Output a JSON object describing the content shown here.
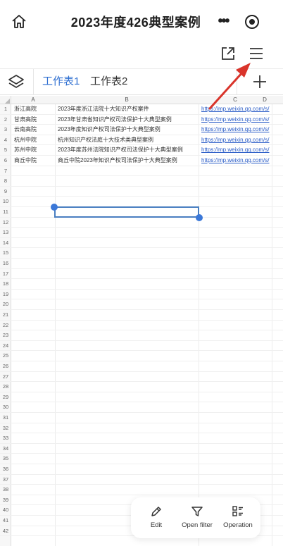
{
  "header": {
    "title": "2023年度426典型案例",
    "more_label": "•••"
  },
  "sheet_tabs": [
    {
      "label": "工作表1",
      "active": true
    },
    {
      "label": "工作表2",
      "active": false
    }
  ],
  "columns": [
    "A",
    "B",
    "C",
    "D"
  ],
  "rows": [
    {
      "num": "1",
      "a": "浙江高院",
      "b": "2023年度浙江法院十大知识产权案件",
      "c": "https://mp.weixin.qq.com/s/"
    },
    {
      "num": "2",
      "a": "甘肃高院",
      "b": "2023年甘肃省知识产权司法保护十大典型案例",
      "c": "https://mp.weixin.qq.com/s/"
    },
    {
      "num": "3",
      "a": "云南高院",
      "b": "2023年度知识产权司法保护十大典型案例",
      "c": "https://mp.weixin.qq.com/s/"
    },
    {
      "num": "4",
      "a": "杭州中院",
      "b": "杭州知识产权法庭十大技术类典型案例",
      "c": "https://mp.weixin.qq.com/s/"
    },
    {
      "num": "5",
      "a": "苏州中院",
      "b": "2023年度苏州法院知识产权司法保护十大典型案例",
      "c": "https://mp.weixin.qq.com/s/"
    },
    {
      "num": "6",
      "a": "商丘中院",
      "b": "商丘中院2023年知识产权司法保护十大典型案例",
      "c": "https://mp.weixin.qq.com/s/"
    }
  ],
  "row_numbers": [
    "7",
    "8",
    "9",
    "10",
    "11",
    "12",
    "13",
    "14",
    "15",
    "16",
    "17",
    "18",
    "19",
    "20",
    "21",
    "22",
    "23",
    "24",
    "25",
    "26",
    "27",
    "28",
    "29",
    "30",
    "31",
    "32",
    "33",
    "34",
    "35",
    "36",
    "37",
    "38",
    "39",
    "40",
    "41",
    "42"
  ],
  "bottom_actions": {
    "edit": "Edit",
    "filter": "Open filter",
    "operation": "Operation"
  },
  "colors": {
    "accent": "#2f6fd1",
    "link": "#2a5cc7",
    "selection": "#4a7fc1",
    "arrow": "#d9342b"
  },
  "icons": [
    "home-icon",
    "more-icon",
    "target-icon",
    "share-icon",
    "menu-icon",
    "layers-icon",
    "plus-icon",
    "edit-icon",
    "filter-icon",
    "operation-icon"
  ]
}
